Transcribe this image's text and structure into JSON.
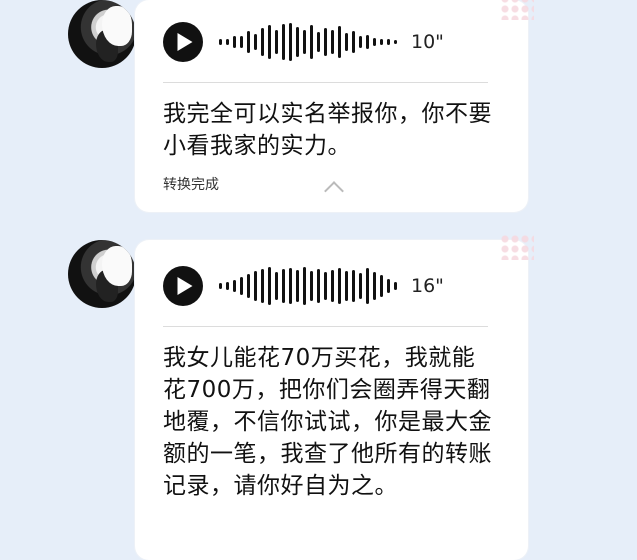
{
  "messages": [
    {
      "duration": "10\"",
      "text": "我完全可以实名举报你，你不要小看我家的实力。",
      "status": "转换完成",
      "wave_levels": [
        0.15,
        0.15,
        0.3,
        0.3,
        0.55,
        0.4,
        0.7,
        0.85,
        0.6,
        0.9,
        0.95,
        0.75,
        0.6,
        0.85,
        0.5,
        0.7,
        0.6,
        0.8,
        0.45,
        0.55,
        0.3,
        0.35,
        0.2,
        0.15,
        0.15,
        0.1
      ]
    },
    {
      "duration": "16\"",
      "text": "我女儿能花70万买花，我就能花700万，把你们会圈弄得天翻地覆，不信你试试，你是最大金额的一笔，我查了他所有的转账记录，请你好自为之。",
      "wave_levels": [
        0.15,
        0.2,
        0.3,
        0.45,
        0.6,
        0.75,
        0.85,
        0.95,
        0.7,
        0.85,
        0.9,
        0.8,
        0.95,
        0.75,
        0.85,
        0.7,
        0.8,
        0.9,
        0.75,
        0.8,
        0.65,
        0.9,
        0.7,
        0.55,
        0.35,
        0.2
      ]
    }
  ],
  "icons": {
    "play": "play-icon",
    "expand": "chevron-up-icon"
  }
}
